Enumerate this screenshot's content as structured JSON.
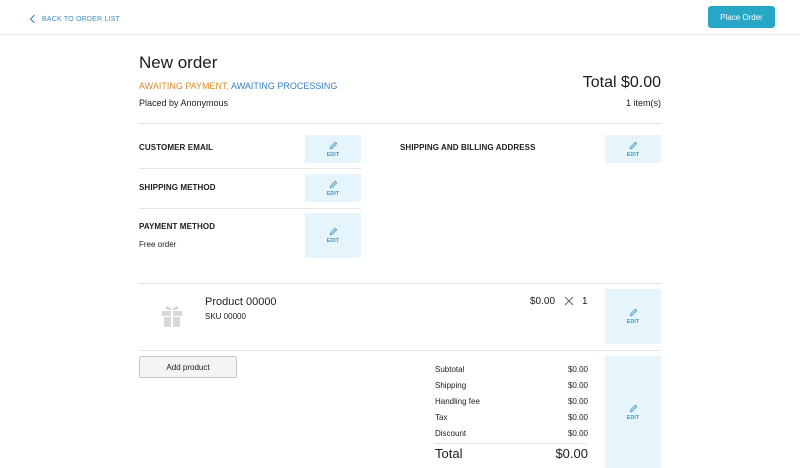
{
  "header": {
    "back_label": "BACK TO ORDER LIST",
    "place_order_label": "Place Order"
  },
  "order": {
    "title": "New order",
    "status_payment": "AWAITING PAYMENT",
    "status_sep": ",",
    "status_processing": "AWAITING PROCESSING",
    "placed_by": "Placed by Anonymous",
    "total": "Total $0.00",
    "item_count": "1 item(s)"
  },
  "sections": {
    "customer_email": "CUSTOMER EMAIL",
    "shipping_method": "SHIPPING METHOD",
    "payment_method": "PAYMENT METHOD",
    "payment_value": "Free order",
    "address": "SHIPPING AND BILLING ADDRESS",
    "edit_label": "EDIT"
  },
  "product": {
    "name": "Product 00000",
    "sku": "SKU  00000",
    "price": "$0.00",
    "quantity": "1",
    "icon": "gift-icon"
  },
  "add_product_label": "Add product",
  "summary": {
    "rows": [
      {
        "label": "Subtotal",
        "value": "$0.00"
      },
      {
        "label": "Shipping",
        "value": "$0.00"
      },
      {
        "label": "Handling fee",
        "value": "$0.00"
      },
      {
        "label": "Tax",
        "value": "$0.00"
      },
      {
        "label": "Discount",
        "value": "$0.00"
      }
    ],
    "total_label": "Total",
    "total_value": "$0.00"
  },
  "colors": {
    "accent": "#27a6c6",
    "link": "#3b8fc4",
    "status_payment": "#d78c2a",
    "status_processing": "#3b7fc0",
    "edit_bg": "#e5f5fb"
  }
}
